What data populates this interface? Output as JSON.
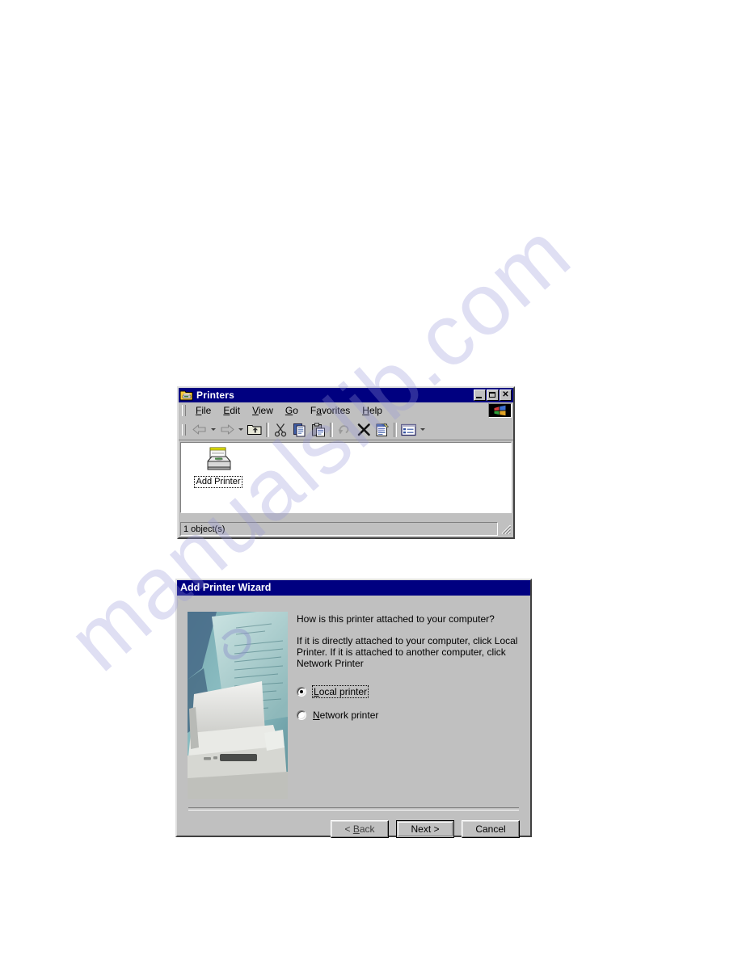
{
  "page": {
    "watermark": "manualslib.com",
    "background_color": "#ffffff"
  },
  "printers_window": {
    "title": "Printers",
    "title_icon": "printers-folder-icon",
    "titlebar_color": "#000080",
    "window_buttons": [
      {
        "name": "minimize",
        "glyph": "_"
      },
      {
        "name": "maximize",
        "glyph": "□"
      },
      {
        "name": "close",
        "glyph": "✕"
      }
    ],
    "menu": [
      {
        "label": "File",
        "mnemonic": "F"
      },
      {
        "label": "Edit",
        "mnemonic": "E"
      },
      {
        "label": "View",
        "mnemonic": "V"
      },
      {
        "label": "Go",
        "mnemonic": "G"
      },
      {
        "label": "Favorites",
        "mnemonic": "a"
      },
      {
        "label": "Help",
        "mnemonic": "H"
      }
    ],
    "logo": "windows-logo-icon",
    "toolbar": [
      {
        "name": "back-button",
        "icon": "arrow-left-icon",
        "dropdown": true
      },
      {
        "name": "forward-button",
        "icon": "arrow-right-icon",
        "dropdown": true
      },
      {
        "name": "up-button",
        "icon": "folder-up-icon",
        "dropdown": false
      },
      {
        "name": "cut-button",
        "icon": "scissors-icon",
        "dropdown": false
      },
      {
        "name": "copy-button",
        "icon": "copy-icon",
        "dropdown": false
      },
      {
        "name": "paste-button",
        "icon": "clipboard-paste-icon",
        "dropdown": false
      },
      {
        "name": "undo-button",
        "icon": "undo-arrow-icon",
        "dropdown": false
      },
      {
        "name": "delete-button",
        "icon": "x-delete-icon",
        "dropdown": false
      },
      {
        "name": "properties-button",
        "icon": "properties-icon",
        "dropdown": false
      },
      {
        "name": "views-button",
        "icon": "views-list-icon",
        "dropdown": true
      }
    ],
    "items": [
      {
        "label": "Add Printer",
        "icon": "add-printer-icon",
        "selected": true
      }
    ],
    "statusbar": "1 object(s)"
  },
  "wizard": {
    "title": "Add Printer Wizard",
    "titlebar_color": "#000080",
    "illustration": "printer-with-letter-photo",
    "heading": "How is this printer attached to your computer?",
    "body": "If it is directly attached to your computer, click Local Printer. If it is attached to another computer, click Network Printer",
    "options": [
      {
        "label": "Local printer",
        "mnemonic": "L",
        "checked": true,
        "focused": true
      },
      {
        "label": "Network printer",
        "mnemonic": "N",
        "checked": false,
        "focused": false
      }
    ],
    "buttons": [
      {
        "name": "back",
        "label": "< Back",
        "pre": "< ",
        "mnemonic": "B",
        "post": "ack",
        "default": false,
        "disabled": true
      },
      {
        "name": "next",
        "label": "Next >",
        "pre": "Next >",
        "mnemonic": "",
        "post": "",
        "default": true,
        "disabled": false
      },
      {
        "name": "cancel",
        "label": "Cancel",
        "pre": "Cancel",
        "mnemonic": "",
        "post": "",
        "default": false,
        "disabled": false
      }
    ]
  }
}
